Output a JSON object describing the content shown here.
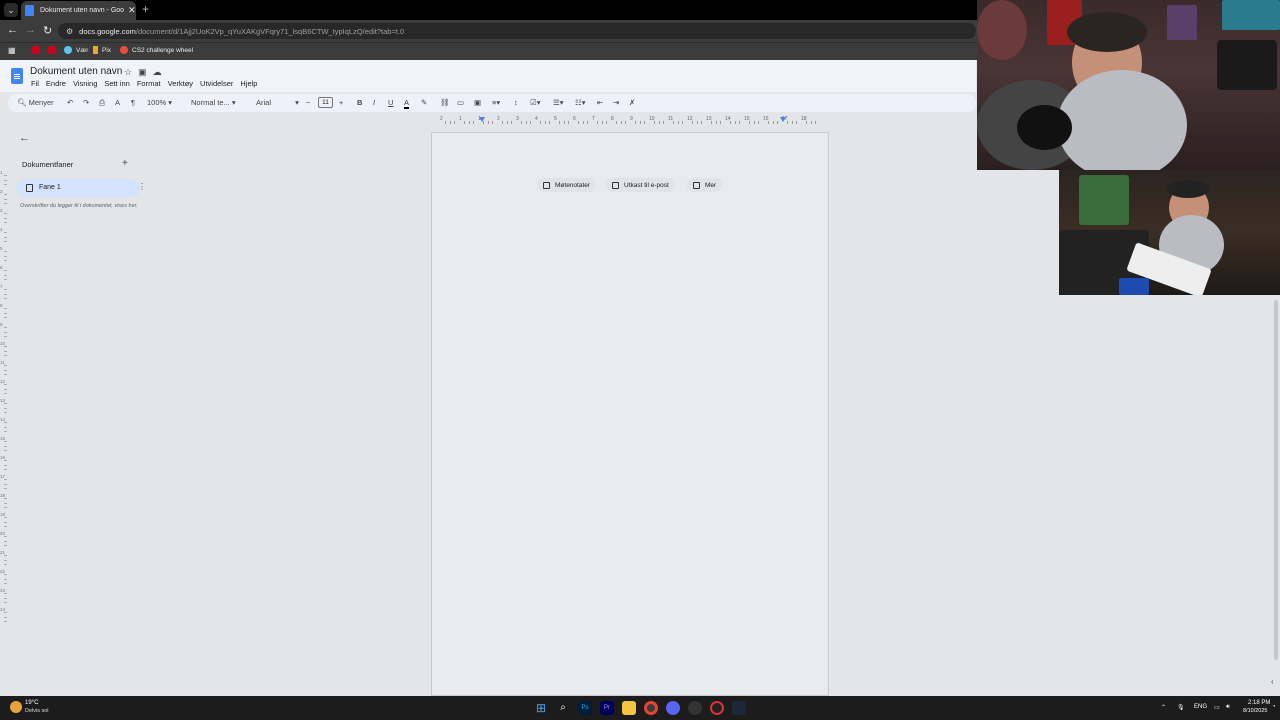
{
  "browser": {
    "tab_title": "Dokument uten navn - Google",
    "tab_close": "✕",
    "new_tab": "+",
    "url_host": "docs.google.com",
    "url_path": "/document/d/1Ajj2UoK2Vp_qYuXAKgVFqry71_lsqB6CTW_typIqLzQ/edit?tab=t.0",
    "bookmarks": [
      "Vær",
      "Pix",
      "CS2 challenge wheel"
    ]
  },
  "docs": {
    "title": "Dokument uten navn",
    "menu": [
      "Fil",
      "Endre",
      "Visning",
      "Sett inn",
      "Format",
      "Verktøy",
      "Utvidelser",
      "Hjelp"
    ],
    "toolbar": {
      "search": "Menyer",
      "zoom": "100%",
      "style": "Normal te...",
      "font": "Arial",
      "font_size": "11"
    },
    "ruler_numbers": [
      "2",
      "1",
      "1",
      "2",
      "3",
      "4",
      "5",
      "6",
      "7",
      "8",
      "9",
      "10",
      "11",
      "12",
      "13",
      "14",
      "15",
      "16",
      "17",
      "18"
    ],
    "vruler_numbers": [
      "1",
      "2",
      "3",
      "4",
      "5",
      "6",
      "7",
      "8",
      "9",
      "10",
      "11",
      "12",
      "13",
      "14",
      "15",
      "16",
      "17",
      "18",
      "19",
      "20",
      "21",
      "22",
      "23",
      "24"
    ],
    "sidebar": {
      "heading": "Dokumentfaner",
      "tab_label": "Fane 1",
      "hint": "Overskrifter du legger til i dokumentet, vises her."
    },
    "chips": [
      "Møtenotater",
      "Utkast til e-post",
      "Mer"
    ]
  },
  "taskbar": {
    "temperature": "19°C",
    "weather": "Delvis sol",
    "language": "ENG",
    "time": "2:18 PM",
    "date": "8/10/2025"
  },
  "colors": {
    "accent": "#4285f4",
    "page_bg": "#e3e5e8",
    "tab_active": "#d3e3fd"
  }
}
